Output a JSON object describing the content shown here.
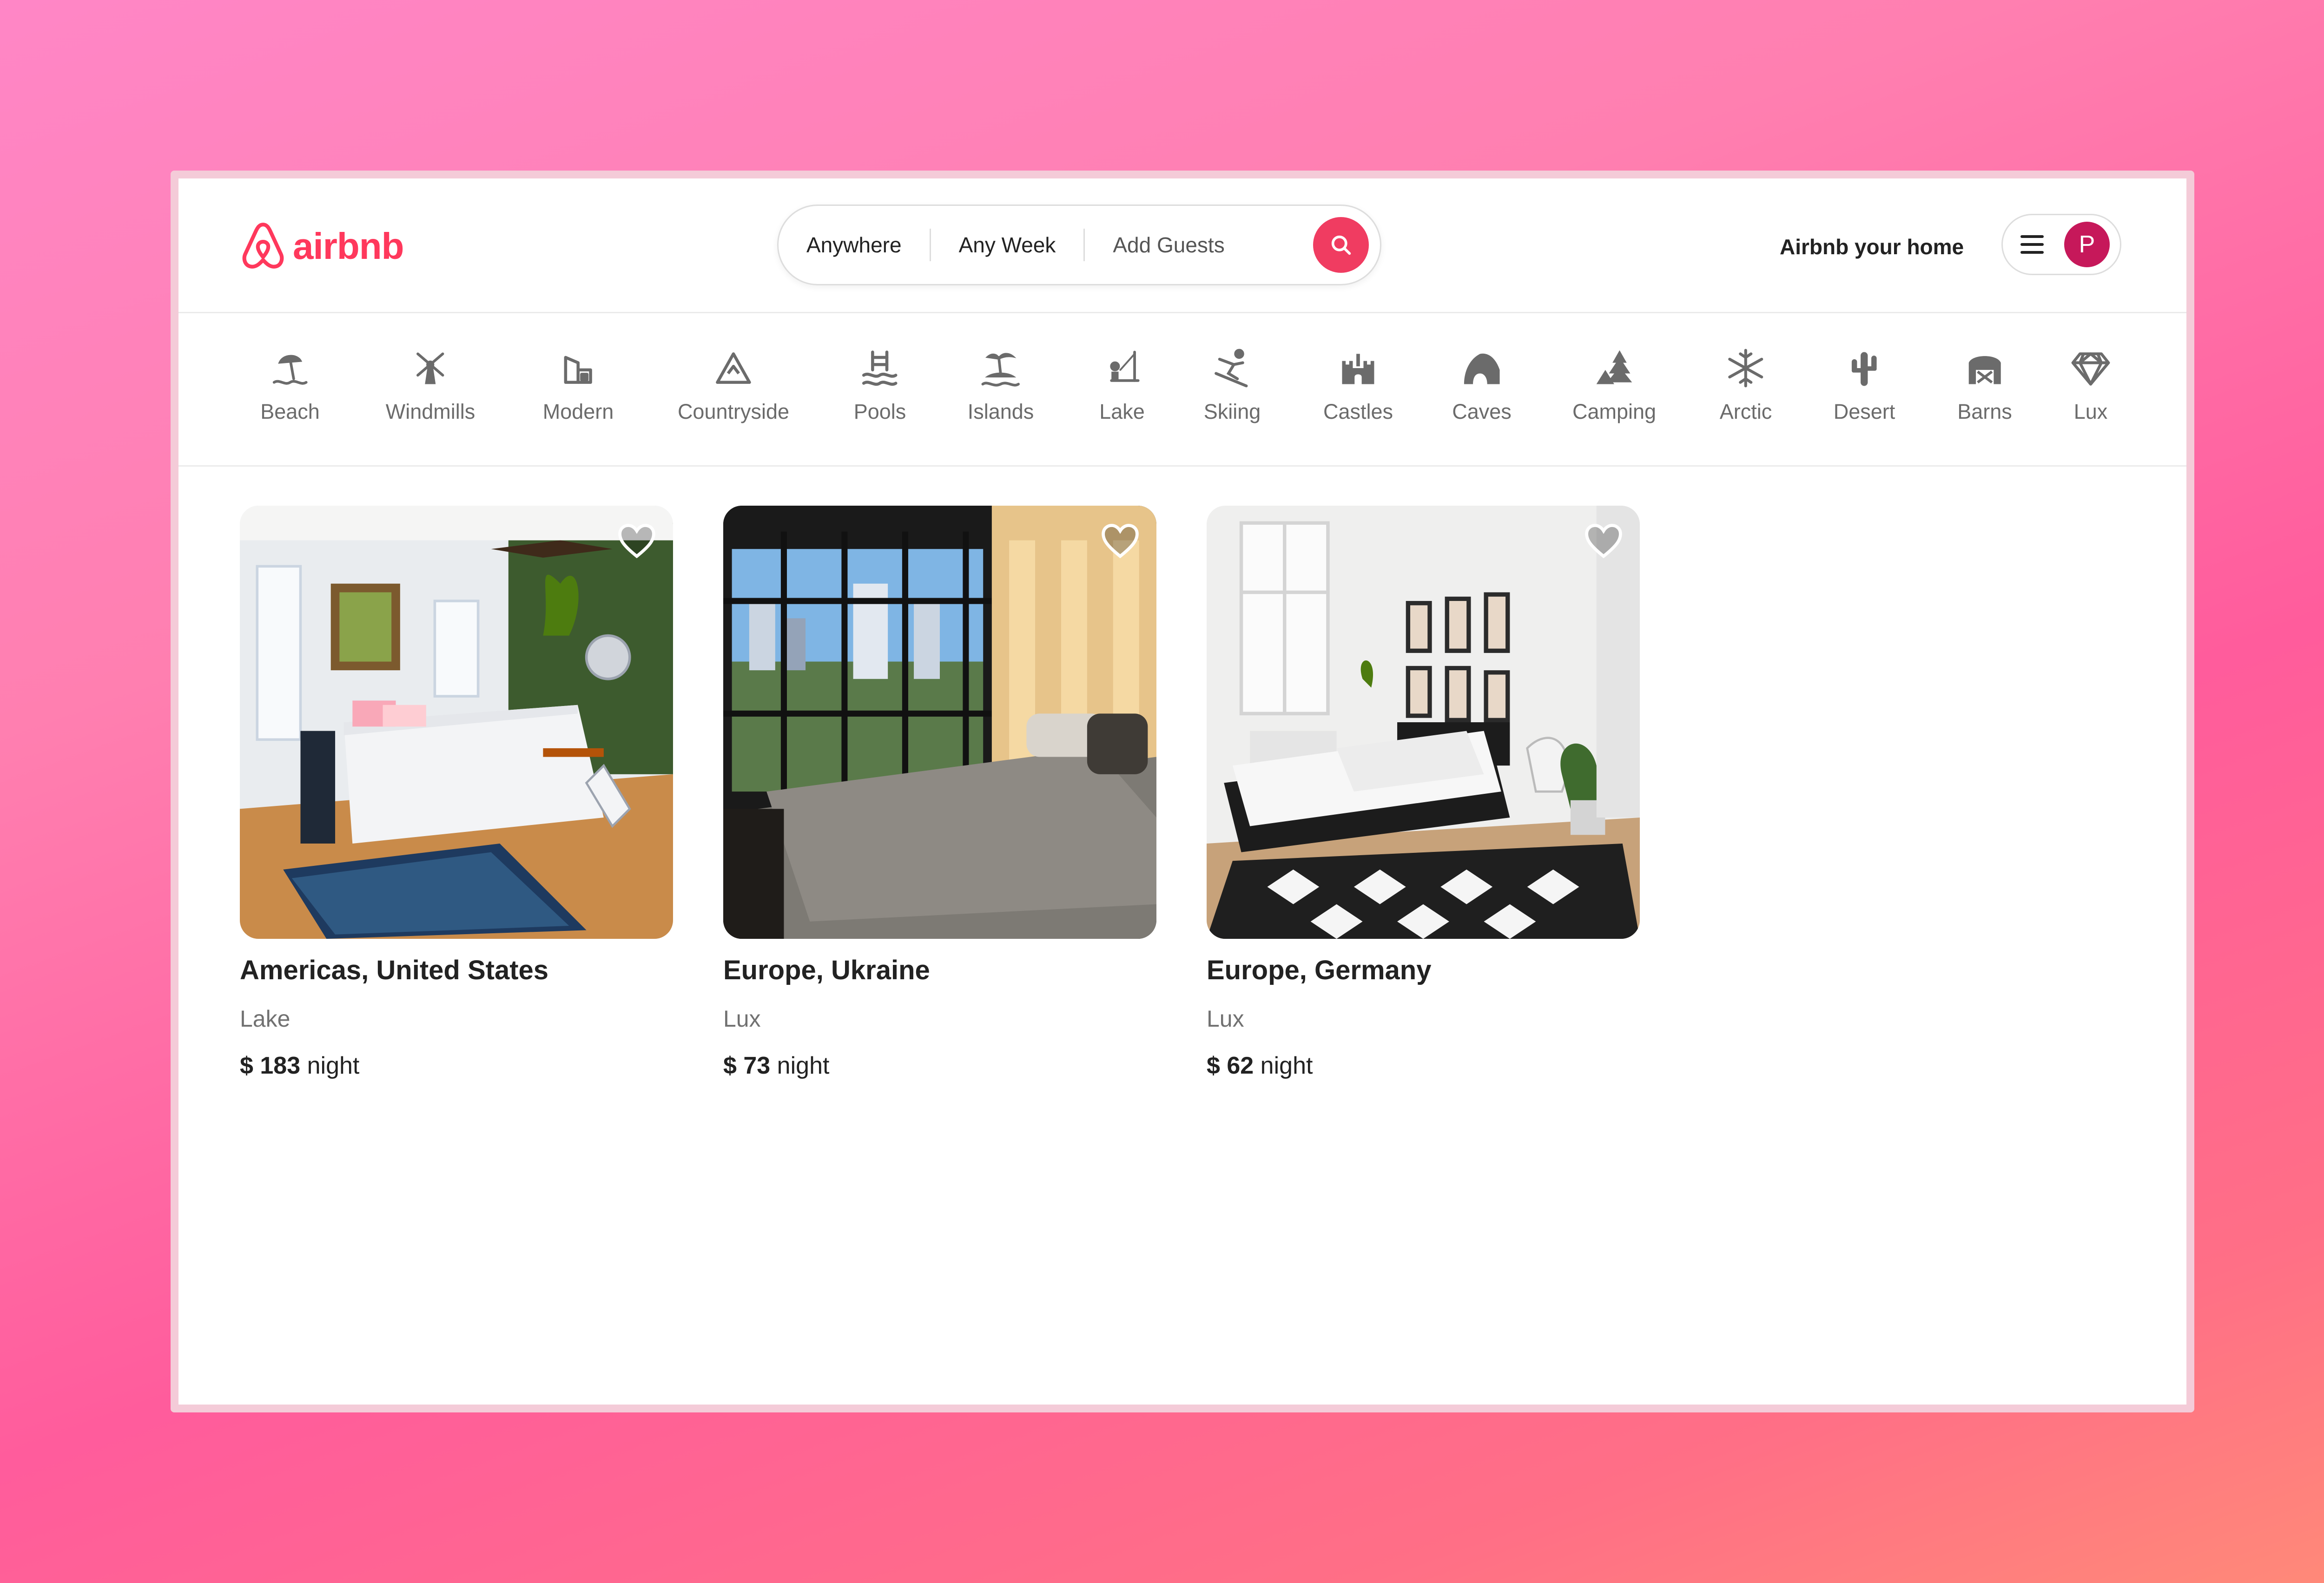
{
  "brand": {
    "name": "airbnb",
    "color": "#ff385c"
  },
  "search": {
    "where": "Anywhere",
    "when": "Any Week",
    "guests": "Add Guests",
    "search_icon": "search-icon",
    "accent": "#f03c61"
  },
  "header": {
    "host_link": "Airbnb your home",
    "menu_icon": "hamburger-icon",
    "avatar_initial": "P",
    "avatar_color": "#c6185a"
  },
  "categories": [
    {
      "label": "Beach",
      "icon": "beach-icon"
    },
    {
      "label": "Windmills",
      "icon": "windmill-icon"
    },
    {
      "label": "Modern",
      "icon": "modern-icon"
    },
    {
      "label": "Countryside",
      "icon": "countryside-icon"
    },
    {
      "label": "Pools",
      "icon": "pool-icon"
    },
    {
      "label": "Islands",
      "icon": "island-icon"
    },
    {
      "label": "Lake",
      "icon": "lake-icon"
    },
    {
      "label": "Skiing",
      "icon": "skiing-icon"
    },
    {
      "label": "Castles",
      "icon": "castle-icon"
    },
    {
      "label": "Caves",
      "icon": "cave-icon"
    },
    {
      "label": "Camping",
      "icon": "camping-icon"
    },
    {
      "label": "Arctic",
      "icon": "snowflake-icon"
    },
    {
      "label": "Desert",
      "icon": "cactus-icon"
    },
    {
      "label": "Barns",
      "icon": "barn-icon"
    },
    {
      "label": "Lux",
      "icon": "diamond-icon"
    }
  ],
  "listings": [
    {
      "title": "Americas, United States",
      "category": "Lake",
      "price": "$ 183",
      "unit": "night"
    },
    {
      "title": "Europe, Ukraine",
      "category": "Lux",
      "price": "$ 73",
      "unit": "night"
    },
    {
      "title": "Europe, Germany",
      "category": "Lux",
      "price": "$ 62",
      "unit": "night"
    }
  ]
}
